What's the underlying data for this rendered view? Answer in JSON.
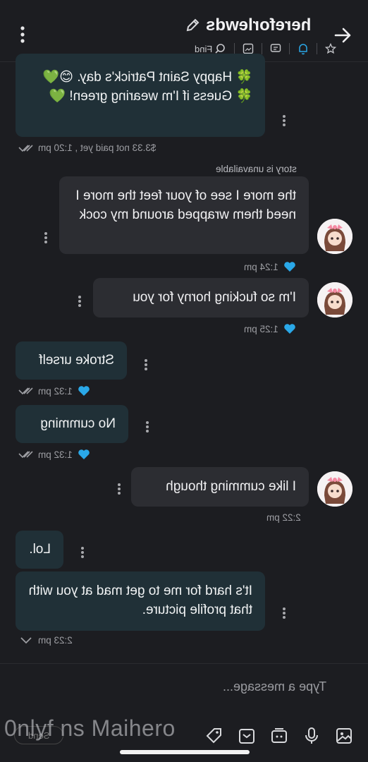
{
  "header": {
    "title": "hereforlewds",
    "find_label": "Find"
  },
  "messages": {
    "m1_text": "🍀 Happy Saint Patrick's day. 😊💚🍀 Guess if I'm wearing green! 💚",
    "m1_meta": "$3.33 not paid yet , 1:20 pm",
    "story_note": "story is unavailable",
    "m2_text": "the more I see of your feet the more I need them wrapped around my cock",
    "m2_time": "1:24 pm",
    "m3_text": "I'm so fucking horny for you",
    "m3_time": "1:25 pm",
    "m4_text": "Stroke urself",
    "m4_time": "1:32 pm",
    "m5_text": "No cumming",
    "m5_time": "1:32 pm",
    "m6_text": "I like cumming though",
    "m6_time": "2:22 pm",
    "m7_text": "Lol.",
    "m8_text": "It's hard for me to get mad at you with that profile picture.",
    "m8_time": "2:23 pm"
  },
  "composer": {
    "placeholder": "Type a message...",
    "send_label": "Send"
  },
  "watermark": "0nlyf ns Maihero",
  "colors": {
    "accent": "#2aa8e8",
    "background": "#1c1d21",
    "incoming_bubble": "#203037",
    "outgoing_bubble": "#2c2d32"
  }
}
